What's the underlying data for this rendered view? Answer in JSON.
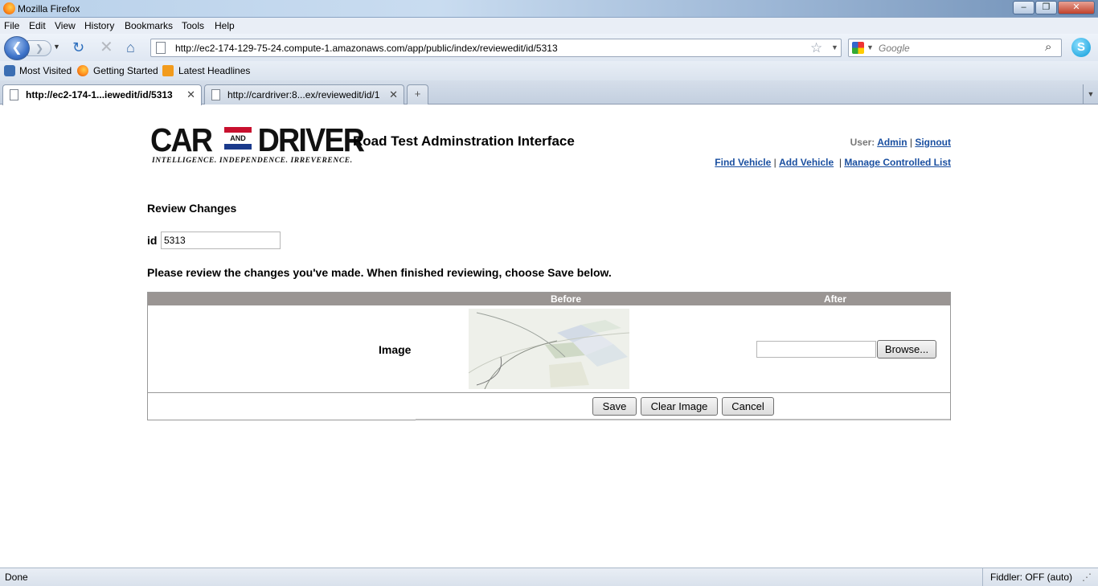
{
  "window": {
    "title": "Mozilla Firefox",
    "min": "–",
    "max": "❐",
    "close": "✕"
  },
  "menu": [
    "File",
    "Edit",
    "View",
    "History",
    "Bookmarks",
    "Tools",
    "Help"
  ],
  "nav": {
    "back": "❮",
    "forward": "❯",
    "reload": "↻",
    "stop": "✕",
    "home": "⌂",
    "url": "http://ec2-174-129-75-24.compute-1.amazonaws.com/app/public/index/reviewedit/id/5313",
    "search_placeholder": "Google",
    "star": "☆",
    "magnifier": "⌕",
    "skype": "S"
  },
  "bookmarks": [
    "Most Visited",
    "Getting Started",
    "Latest Headlines"
  ],
  "tabs": [
    {
      "label": "http://ec2-174-1...iewedit/id/5313",
      "close": "✕"
    },
    {
      "label": "http://cardriver:8...ex/reviewedit/id/1",
      "close": "✕"
    }
  ],
  "newtab": "+",
  "page": {
    "logo": {
      "main": "CAR   DRIVER",
      "and": "AND",
      "tagline": "INTELLIGENCE. INDEPENDENCE. IRREVERENCE."
    },
    "title": "Road Test Adminstration Interface",
    "user_label": "User:",
    "user_name": "Admin",
    "signout": "Signout",
    "links": [
      "Find Vehicle",
      "Add Vehicle",
      "Manage Controlled List"
    ],
    "section_heading": "Review Changes",
    "id_label": "id",
    "id_value": "5313",
    "instructions": "Please review the changes you've made. When finished reviewing, choose Save below.",
    "table": {
      "before_header": "Before",
      "after_header": "After",
      "row_label": "Image",
      "browse": "Browse..."
    },
    "buttons": {
      "save": "Save",
      "clear_image": "Clear Image",
      "cancel": "Cancel"
    }
  },
  "status": {
    "text": "Done",
    "fiddler": "Fiddler: OFF (auto)"
  },
  "colors": {
    "link": "#1a4fa0",
    "table_header": "#9a9593",
    "logo_red": "#c8102e",
    "logo_blue": "#1a3a8c"
  }
}
